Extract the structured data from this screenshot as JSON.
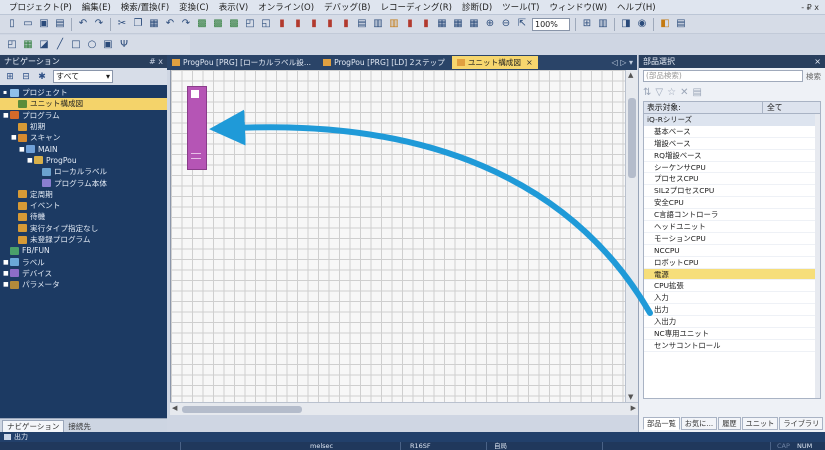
{
  "menu": [
    "プロジェクト(P)",
    "編集(E)",
    "検索/置換(F)",
    "変換(C)",
    "表示(V)",
    "オンライン(O)",
    "デバッグ(B)",
    "レコーディング(R)",
    "診断(D)",
    "ツール(T)",
    "ウィンドウ(W)",
    "ヘルプ(H)"
  ],
  "window_controls": "- ₽ x",
  "toolbar": {
    "zoom": "100%"
  },
  "nav": {
    "title": "ナビゲーション",
    "header_controls": "# x",
    "filter_value": "すべて",
    "tree": [
      {
        "label": "プロジェクト",
        "level": 0,
        "icon": "proj",
        "exp": "▪"
      },
      {
        "label": "ユニット構成図",
        "level": 1,
        "icon": "unit",
        "selected": true
      },
      {
        "label": "プログラム",
        "level": 0,
        "icon": "prog",
        "exp": "■"
      },
      {
        "label": "初期",
        "level": 1,
        "icon": "fold"
      },
      {
        "label": "スキャン",
        "level": 1,
        "icon": "scan",
        "exp": "■"
      },
      {
        "label": "MAIN",
        "level": 2,
        "icon": "main",
        "exp": "■"
      },
      {
        "label": "ProgPou",
        "level": 3,
        "icon": "pou",
        "exp": "■"
      },
      {
        "label": "ローカルラベル",
        "level": 4,
        "icon": "loc"
      },
      {
        "label": "プログラム本体",
        "level": 4,
        "icon": "body"
      },
      {
        "label": "定周期",
        "level": 1,
        "icon": "fold"
      },
      {
        "label": "イベント",
        "level": 1,
        "icon": "fold"
      },
      {
        "label": "待機",
        "level": 1,
        "icon": "fold"
      },
      {
        "label": "実行タイプ指定なし",
        "level": 1,
        "icon": "fold"
      },
      {
        "label": "未登録プログラム",
        "level": 1,
        "icon": "fold"
      },
      {
        "label": "FB/FUN",
        "level": 0,
        "icon": "fb"
      },
      {
        "label": "ラベル",
        "level": 0,
        "icon": "lbl",
        "exp": "■"
      },
      {
        "label": "デバイス",
        "level": 0,
        "icon": "dev",
        "exp": "■"
      },
      {
        "label": "パラメータ",
        "level": 0,
        "icon": "prm",
        "exp": "■"
      }
    ],
    "bottom_tabs": [
      "ナビゲーション",
      "接続先"
    ]
  },
  "doc_tabs": [
    {
      "label": "ProgPou [PRG] [ローカルラベル設...",
      "active": false
    },
    {
      "label": "ProgPou [PRG] [LD] 2ステップ",
      "active": false
    },
    {
      "label": "ユニット構成図",
      "active": true,
      "close": "×"
    }
  ],
  "doc_tab_controls": "◁ ▷ ▾",
  "parts": {
    "title": "部品選択",
    "header_controls": "×",
    "search_placeholder": "(部品検索)",
    "search_btn": "検索",
    "display_label": "表示対象:",
    "display_value": "全て",
    "category": "iQ-Rシリーズ",
    "items": [
      "基本ベース",
      "増設ベース",
      "RQ増設ベース",
      "シーケンサCPU",
      "プロセスCPU",
      "SIL2プロセスCPU",
      "安全CPU",
      "C言語コントローラ",
      "ヘッドユニット",
      "モーションCPU",
      "NCCPU",
      "ロボットCPU",
      "電源",
      "CPU拡張",
      "入力",
      "出力",
      "入出力",
      "NC専用ユニット",
      "センサコントロール"
    ],
    "highlight_index": 12,
    "tabs": [
      "部品一覧",
      "お気に...",
      "履歴",
      "ユニット",
      "ライブラリ"
    ]
  },
  "output_tab": "出力",
  "status": {
    "a": "melsec",
    "b": "R16SF",
    "c": "自局",
    "d": "CAP",
    "e": "NUM"
  },
  "colors": {
    "arrow": "#1f9ad8",
    "unit_block": "#b555b5",
    "selected": "#f4d36a"
  }
}
